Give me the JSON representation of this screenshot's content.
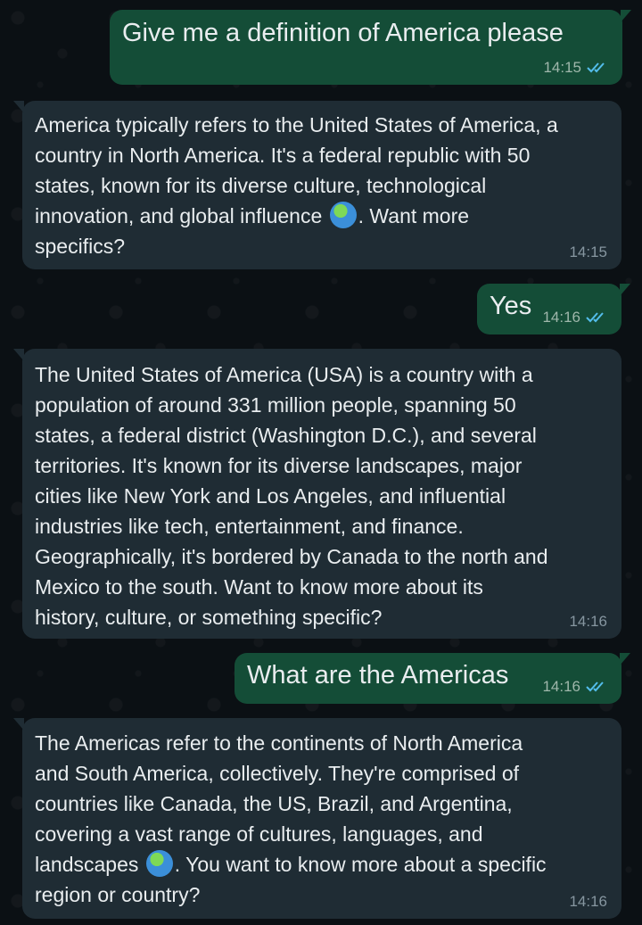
{
  "messages": [
    {
      "text": "Give me a definition of America please",
      "time": "14:15"
    },
    {
      "parts": [
        "America typically refers to the United States of America, a\ncountry in North America. It's a federal republic with 50\nstates, known for its diverse culture, technological\ninnovation, and global influence ",
        ". Want more\nspecifics?"
      ],
      "time": "14:15"
    },
    {
      "text": "Yes",
      "time": "14:16"
    },
    {
      "text": "The United States of America (USA) is a country with a\npopulation of around 331 million people, spanning 50\nstates, a federal district (Washington D.C.), and several\nterritories. It's known for its diverse landscapes, major\ncities like New York and Los Angeles, and influential\nindustries like tech, entertainment, and finance.\nGeographically, it's bordered by Canada to the north and\nMexico to the south. Want to know more about its\nhistory, culture, or something specific?",
      "time": "14:16"
    },
    {
      "text": "What are the Americas",
      "time": "14:16"
    },
    {
      "parts": [
        "The Americas refer to the continents of North America\nand South America, collectively. They're comprised of\ncountries like Canada, the US, Brazil, and Argentina,\ncovering a vast range of cultures, languages, and\nlandscapes ",
        ". You want to know more about a specific\nregion or country?"
      ],
      "time": "14:16"
    }
  ],
  "icons": {
    "globe": "globe-earth-americas-emoji",
    "read_receipt": "double-check-icon"
  },
  "colors": {
    "background": "#0b1014",
    "outgoing": "#144d37",
    "incoming": "#1f2c34",
    "read_tick": "#53bdeb"
  }
}
